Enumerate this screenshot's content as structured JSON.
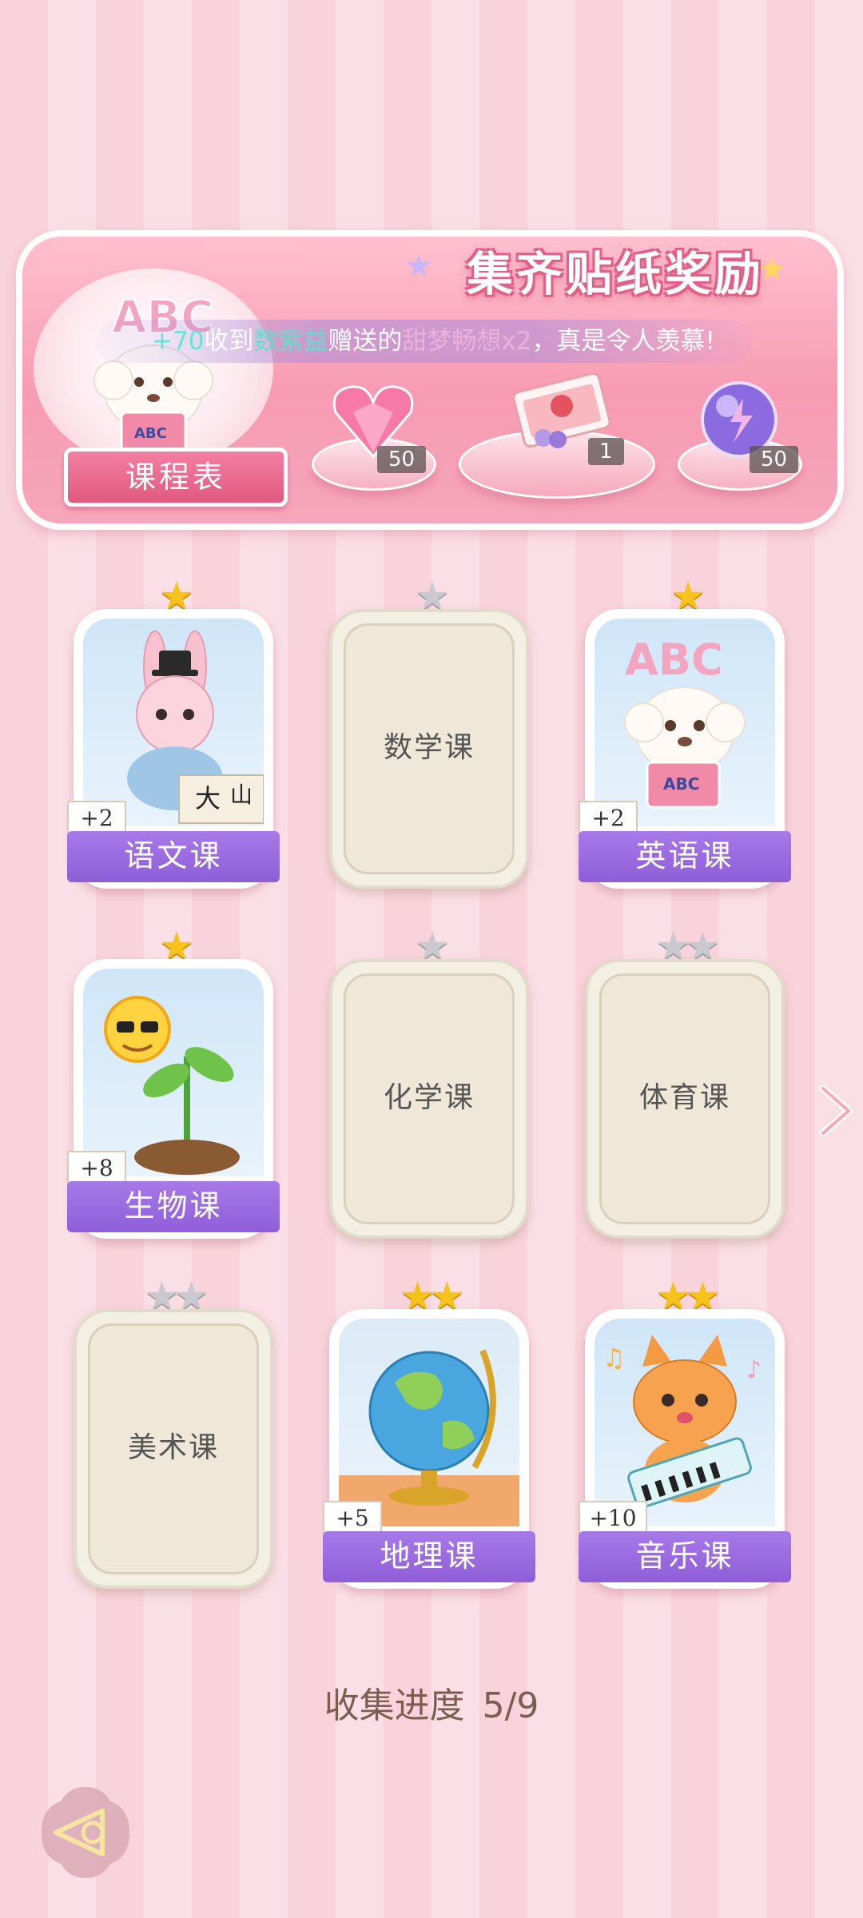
{
  "banner": {
    "title": "集齐贴纸奖励",
    "ticker": {
      "amount": "+70",
      "received": "收到",
      "sender": "数紫益",
      "gave": "赠送的",
      "item": "甜梦畅想x2",
      "suffix": "，真是令人羡慕!"
    },
    "schedule_label": "课程表",
    "schedule_art_letters": "ABC",
    "rewards": [
      {
        "icon": "pink-heart-gem-icon",
        "count": "50"
      },
      {
        "icon": "gift-box-icon",
        "count": "1"
      },
      {
        "icon": "purple-energy-orb-icon",
        "count": "50"
      }
    ]
  },
  "cards": [
    {
      "name": "语文课",
      "stars": 1,
      "collected": true,
      "bonus": "+2",
      "art": "rabbit-calligraphy"
    },
    {
      "name": "数学课",
      "stars": 1,
      "collected": false
    },
    {
      "name": "英语课",
      "stars": 1,
      "collected": true,
      "bonus": "+2",
      "art": "puppy-abc",
      "art_letters": "ABC"
    },
    {
      "name": "生物课",
      "stars": 1,
      "collected": true,
      "bonus": "+8",
      "art": "sun-sprout"
    },
    {
      "name": "化学课",
      "stars": 1,
      "collected": false
    },
    {
      "name": "体育课",
      "stars": 2,
      "collected": false
    },
    {
      "name": "美术课",
      "stars": 2,
      "collected": false
    },
    {
      "name": "地理课",
      "stars": 2,
      "collected": true,
      "bonus": "+5",
      "art": "globe"
    },
    {
      "name": "音乐课",
      "stars": 2,
      "collected": true,
      "bonus": "+10",
      "art": "cat-keyboard"
    }
  ],
  "progress": {
    "label": "收集进度",
    "value": "5/9"
  },
  "colors": {
    "ribbon": "#9b6be0",
    "star_gold": "#f6c21c",
    "star_gray": "#c9c9cf",
    "banner_pink": "#f79bb3"
  }
}
